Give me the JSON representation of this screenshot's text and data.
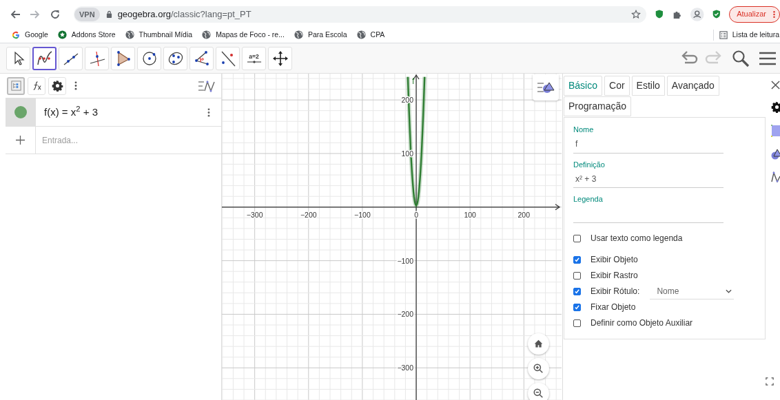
{
  "browser": {
    "nav": [
      {
        "kind": "back",
        "disabled": false
      },
      {
        "kind": "forward",
        "disabled": true
      },
      {
        "kind": "reload",
        "disabled": false
      }
    ],
    "vpn_badge": "VPN",
    "url": {
      "host": "geogebra.org",
      "path": "/classic?lang=pt_PT"
    },
    "update_button": "Atualizar",
    "bookmarks": [
      {
        "kind": "google",
        "label": "Google"
      },
      {
        "kind": "addons",
        "label": "Addons Store"
      },
      {
        "kind": "globe",
        "label": "Thumbnail Mídia"
      },
      {
        "kind": "globe",
        "label": "Mapas de Foco - re..."
      },
      {
        "kind": "globe",
        "label": "Para Escola"
      },
      {
        "kind": "globe",
        "label": "CPA"
      }
    ],
    "reading_list": "Lista de leitura"
  },
  "tools": [
    {
      "kind": "move",
      "selected": false
    },
    {
      "kind": "function",
      "selected": true
    },
    {
      "kind": "line",
      "selected": false
    },
    {
      "kind": "perpendicular",
      "selected": false
    },
    {
      "kind": "polygon",
      "selected": false
    },
    {
      "kind": "circle",
      "selected": false
    },
    {
      "kind": "conic",
      "selected": false
    },
    {
      "kind": "angle",
      "selected": false
    },
    {
      "kind": "reflect",
      "selected": false
    },
    {
      "kind": "slider",
      "selected": false,
      "label": "a=2"
    },
    {
      "kind": "pan",
      "selected": false
    }
  ],
  "algebra": {
    "tabs": [
      {
        "kind": "tree",
        "selected": true
      },
      {
        "kind": "fx",
        "selected": false
      },
      {
        "kind": "gear",
        "selected": false
      }
    ],
    "items": [
      {
        "formula": "f(x) = x$^{2}$ + 3",
        "color": "#6aa56a",
        "visible": true
      }
    ],
    "input_placeholder": "Entrada..."
  },
  "graphics": {
    "chart_data": {
      "type": "line",
      "x": [
        -15.5,
        -15,
        -14,
        -13,
        -12,
        -11,
        -10,
        -9,
        -8,
        -7,
        -6,
        -5,
        -4,
        -3,
        -2,
        -1,
        0,
        1,
        2,
        3,
        4,
        5,
        6,
        7,
        8,
        9,
        10,
        11,
        12,
        13,
        14,
        15,
        15.5
      ],
      "series": [
        {
          "name": "f",
          "color": "#2e7d32",
          "values": [
            243,
            228,
            199,
            172,
            147,
            124,
            103,
            84,
            67,
            52,
            39,
            28,
            19,
            12,
            7,
            4,
            3,
            4,
            7,
            12,
            19,
            28,
            39,
            52,
            67,
            84,
            103,
            124,
            147,
            172,
            199,
            228,
            243
          ]
        }
      ],
      "xlim": [
        -361,
        270
      ],
      "ylim": [
        -360,
        249
      ],
      "xticks": [
        {
          "value": -300,
          "label": "−300"
        },
        {
          "value": -200,
          "label": "−200"
        },
        {
          "value": -100,
          "label": "−100"
        },
        {
          "value": 0,
          "label": "0"
        },
        {
          "value": 100,
          "label": "100"
        },
        {
          "value": 200,
          "label": "200"
        }
      ],
      "grid": true,
      "yticks": [
        {
          "value": -300,
          "label": "−300"
        },
        {
          "value": -200,
          "label": "−200"
        },
        {
          "value": -100,
          "label": "−100"
        },
        {
          "value": 100,
          "label": "100"
        },
        {
          "value": 200,
          "label": "200"
        }
      ]
    }
  },
  "properties": {
    "tabs": [
      {
        "label": "Básico",
        "selected": true
      },
      {
        "label": "Cor",
        "selected": false
      },
      {
        "label": "Estilo",
        "selected": false
      },
      {
        "label": "Avançado",
        "selected": false
      },
      {
        "label": "Programação",
        "selected": false
      }
    ],
    "fields": [
      {
        "label": "Nome",
        "value": "f"
      },
      {
        "label": "Definição",
        "value": "x² + 3"
      },
      {
        "label": "Legenda"
      }
    ],
    "options": [
      {
        "label": "Usar texto como legenda",
        "checked": false
      },
      {
        "label": "Exibir Objeto",
        "checked": true
      },
      {
        "label": "Exibir Rastro",
        "checked": false
      },
      {
        "label": "Exibir Rótulo:",
        "checked": true,
        "dropdown": "Nome"
      },
      {
        "label": "Fixar Objeto",
        "checked": true
      },
      {
        "label": "Definir como Objeto Auxiliar",
        "checked": false
      }
    ]
  }
}
